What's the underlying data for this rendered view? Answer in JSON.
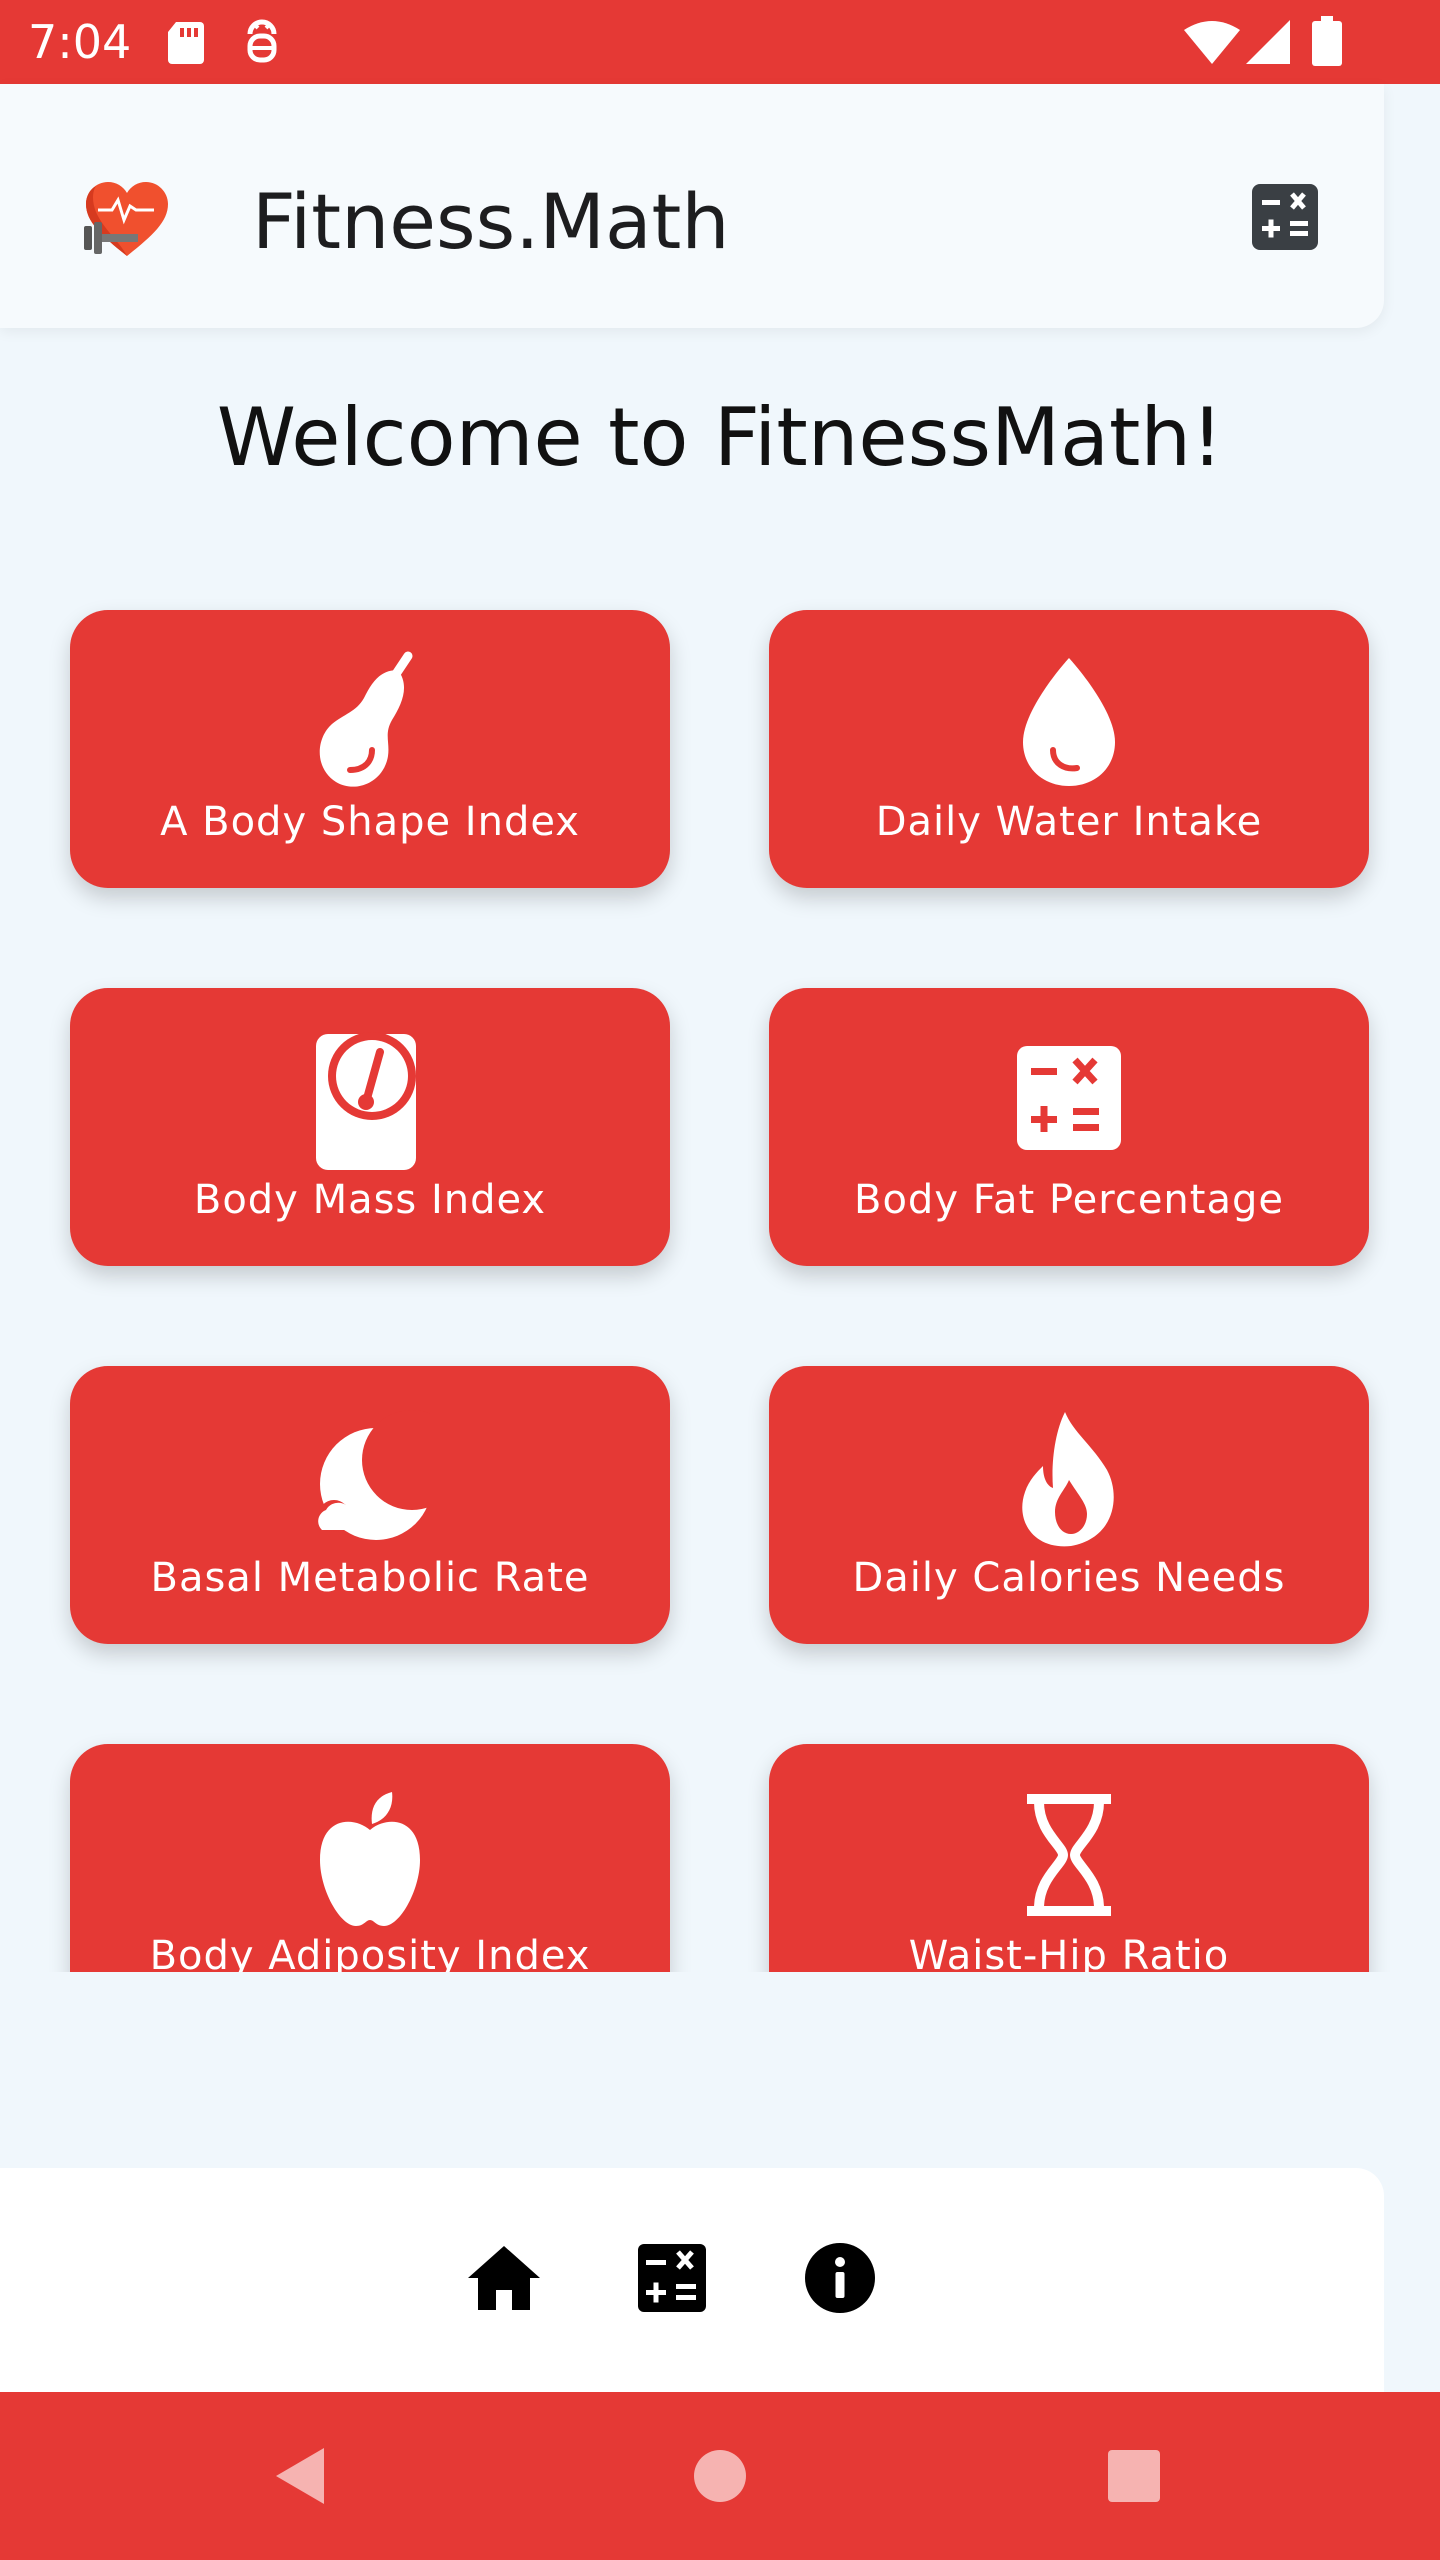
{
  "status_bar": {
    "time": "7:04",
    "icons": [
      "sd-card-icon",
      "debug-icon",
      "wifi-icon",
      "signal-icon",
      "battery-icon"
    ]
  },
  "app_bar": {
    "title": "Fitness.Math",
    "logo_icon": "heart-dumbbell-logo",
    "action_icon": "calculator-icon"
  },
  "welcome_text": "Welcome to FitnessMath!",
  "tiles": [
    {
      "label": "A Body Shape Index",
      "icon": "pear-icon"
    },
    {
      "label": "Daily Water Intake",
      "icon": "water-drop-icon"
    },
    {
      "label": "Body Mass Index",
      "icon": "scale-icon"
    },
    {
      "label": "Body Fat Percentage",
      "icon": "calculator-icon"
    },
    {
      "label": "Basal Metabolic Rate",
      "icon": "moon-cloud-icon"
    },
    {
      "label": "Daily Calories Needs",
      "icon": "flame-icon"
    },
    {
      "label": "Body Adiposity Index",
      "icon": "apple-icon"
    },
    {
      "label": "Waist-Hip Ratio",
      "icon": "hourglass-icon"
    }
  ],
  "bottom_nav": {
    "items": [
      "home-icon",
      "calculator-icon",
      "info-icon"
    ]
  },
  "system_nav": {
    "items": [
      "back-icon",
      "home-circle-icon",
      "recents-icon"
    ]
  },
  "colors": {
    "primary": "#e53935",
    "background": "#f0f7fc",
    "app_bar": "#f6fafd",
    "on_primary": "#ffffff"
  }
}
